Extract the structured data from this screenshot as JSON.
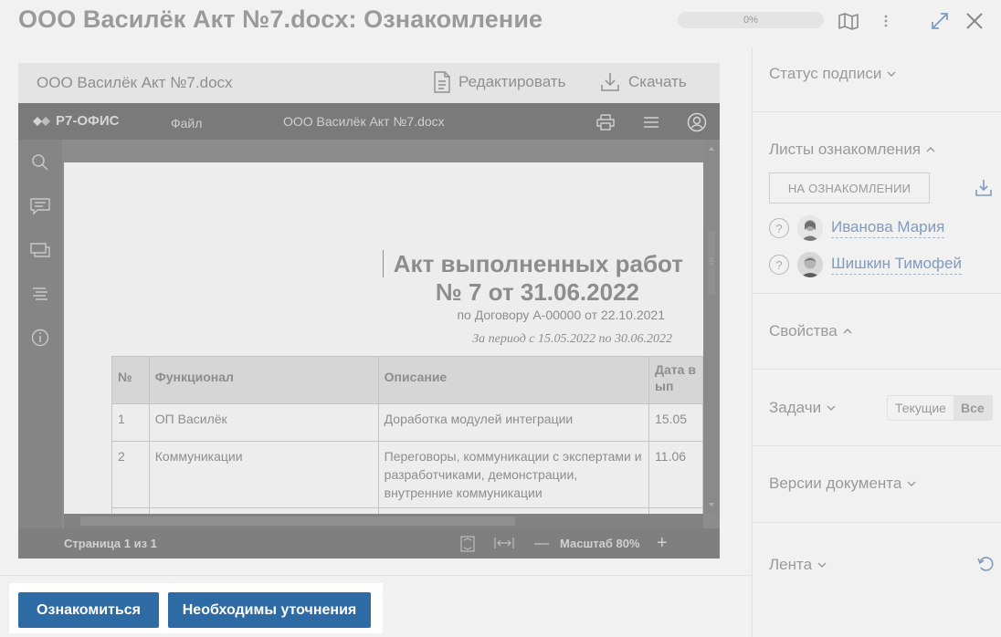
{
  "header": {
    "title": "ООО Василёк Акт №7.docx: Ознакомление",
    "progress": "0%"
  },
  "viewer": {
    "file_name": "ООО Василёк Акт №7.docx",
    "edit_label": "Редактировать",
    "download_label": "Скачать",
    "r7": {
      "logo": "Р7-ОФИС",
      "file_menu": "Файл",
      "doc_name": "ООО Василёк Акт №7.docx"
    },
    "document": {
      "heading_line1": "Акт выполненных работ",
      "heading_line2": "№ 7 от 31.06.2022",
      "contract": "по Договору А-00000 от 22.10.2021",
      "period": "За период с 15.05.2022 по 30.06.2022",
      "table": {
        "headers": [
          "№",
          "Функционал",
          "Описание",
          "Дата вып"
        ],
        "rows": [
          [
            "1",
            "ОП Василёк",
            "Доработка модулей интеграции",
            "15.05"
          ],
          [
            "2",
            "Коммуникации",
            "Переговоры, коммуникации с экспертами и разработчиками, демонстрации, внутренние коммуникации",
            "11.06"
          ]
        ]
      }
    },
    "status": {
      "page": "Страница 1 из 1",
      "zoom": "Масштаб 80%"
    }
  },
  "right_panel": {
    "signature_status": "Статус подписи",
    "review_sheets": "Листы ознакомления",
    "on_review_button": "НА ОЗНАКОМЛЕНИИ",
    "people": [
      {
        "name": "Иванова Мария"
      },
      {
        "name": "Шишкин Тимофей"
      }
    ],
    "properties": "Свойства",
    "tasks": "Задачи",
    "tasks_current": "Текущие",
    "tasks_all": "Все",
    "versions": "Версии документа",
    "feed": "Лента"
  },
  "actions": {
    "acknowledge": "Ознакомиться",
    "need_clarification": "Необходимы уточнения"
  },
  "colors": {
    "primary": "#2e6aa4",
    "link": "#7f9bbd"
  }
}
